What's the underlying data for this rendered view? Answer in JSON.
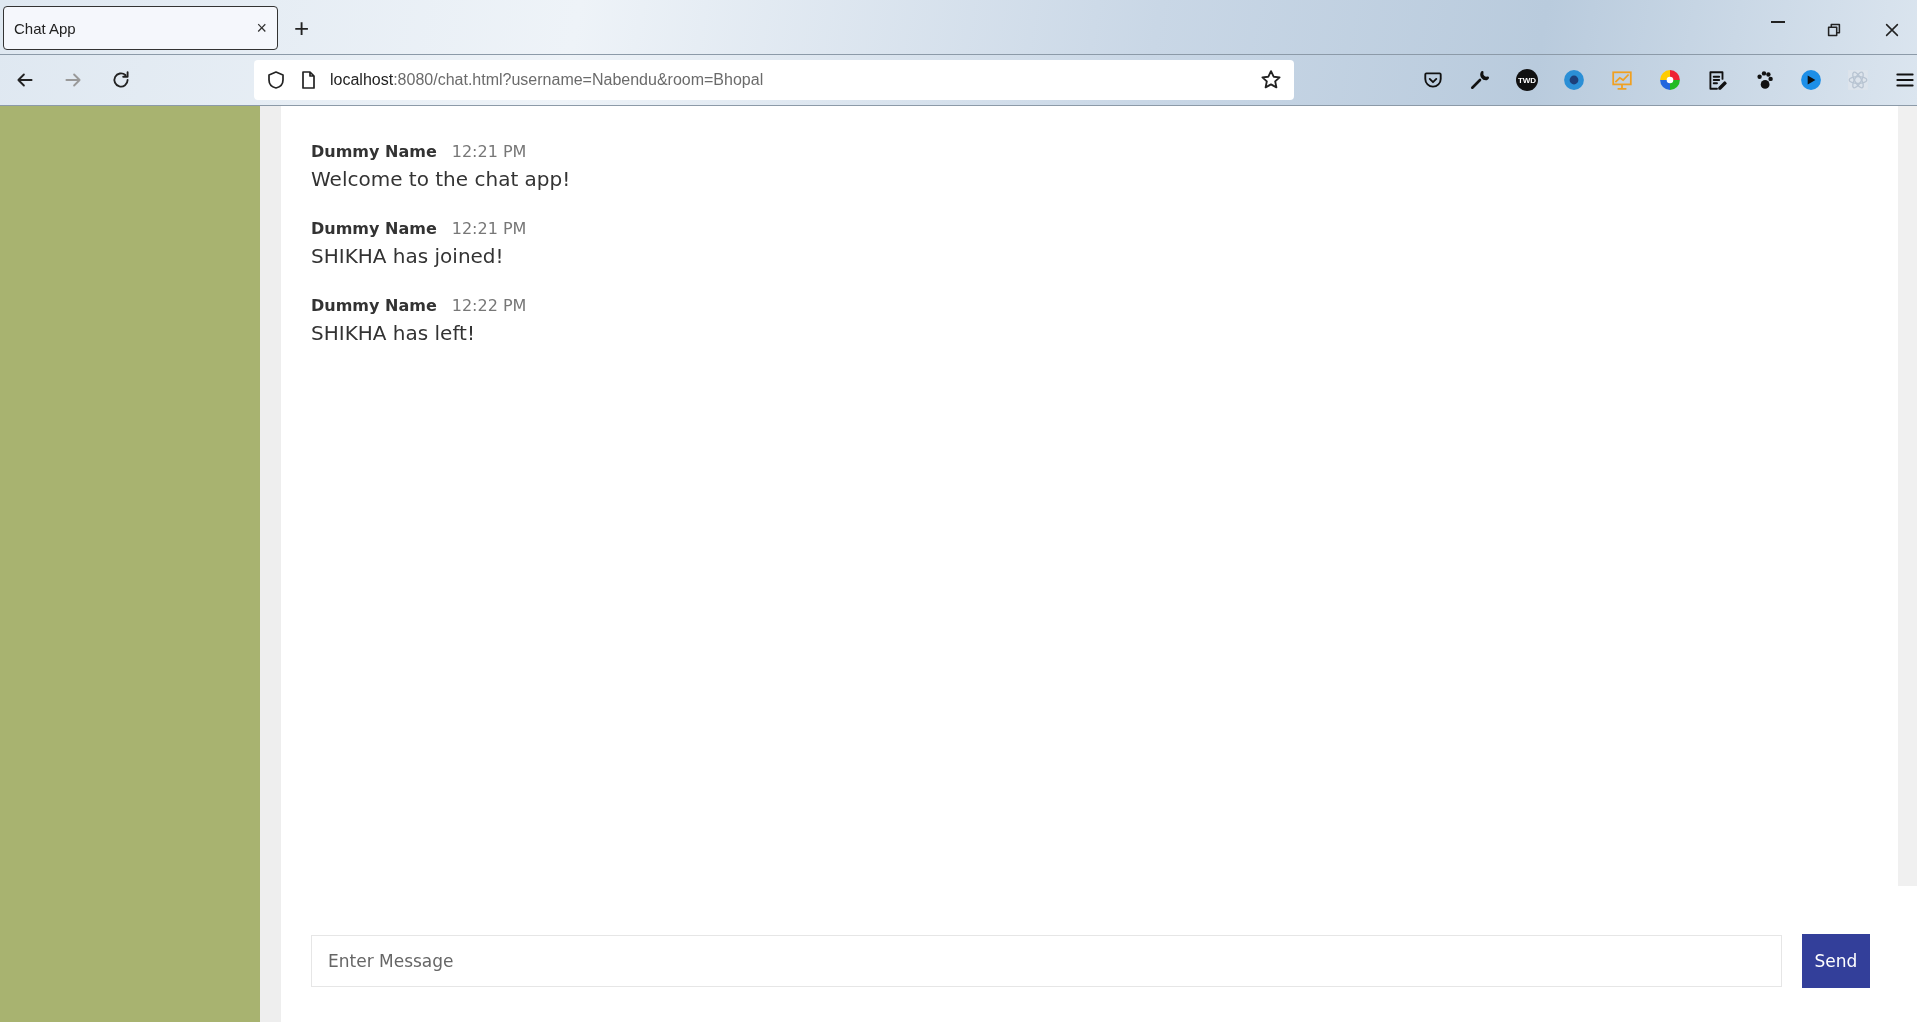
{
  "browser": {
    "tab": {
      "title": "Chat App",
      "close": "×",
      "selected": true
    },
    "new_tab": "+",
    "nav": [
      {
        "kind": "back",
        "disabled": false
      },
      {
        "kind": "forward",
        "disabled": true
      },
      {
        "kind": "reload",
        "disabled": false
      }
    ],
    "url": {
      "host": "localhost",
      "rest": ":8080/chat.html?username=Nabendu&room=Bhopal"
    },
    "extensions": [
      {
        "kind": "pocket"
      },
      {
        "kind": "wrench"
      },
      {
        "kind": "badge",
        "text": "TWD"
      },
      {
        "kind": "globe"
      },
      {
        "kind": "chart"
      },
      {
        "kind": "colorwheel"
      },
      {
        "kind": "notes"
      },
      {
        "kind": "paw"
      },
      {
        "kind": "play"
      },
      {
        "kind": "atom"
      },
      {
        "kind": "menu"
      }
    ]
  },
  "messages": [
    {
      "author": "Dummy Name",
      "time": "12:21 PM",
      "text": "Welcome to the chat app!"
    },
    {
      "author": "Dummy Name",
      "time": "12:21 PM",
      "text": "SHIKHA has joined!"
    },
    {
      "author": "Dummy Name",
      "time": "12:22 PM",
      "text": "SHIKHA has left!"
    }
  ],
  "composer": {
    "placeholder": "Enter Message",
    "button": "Send"
  }
}
